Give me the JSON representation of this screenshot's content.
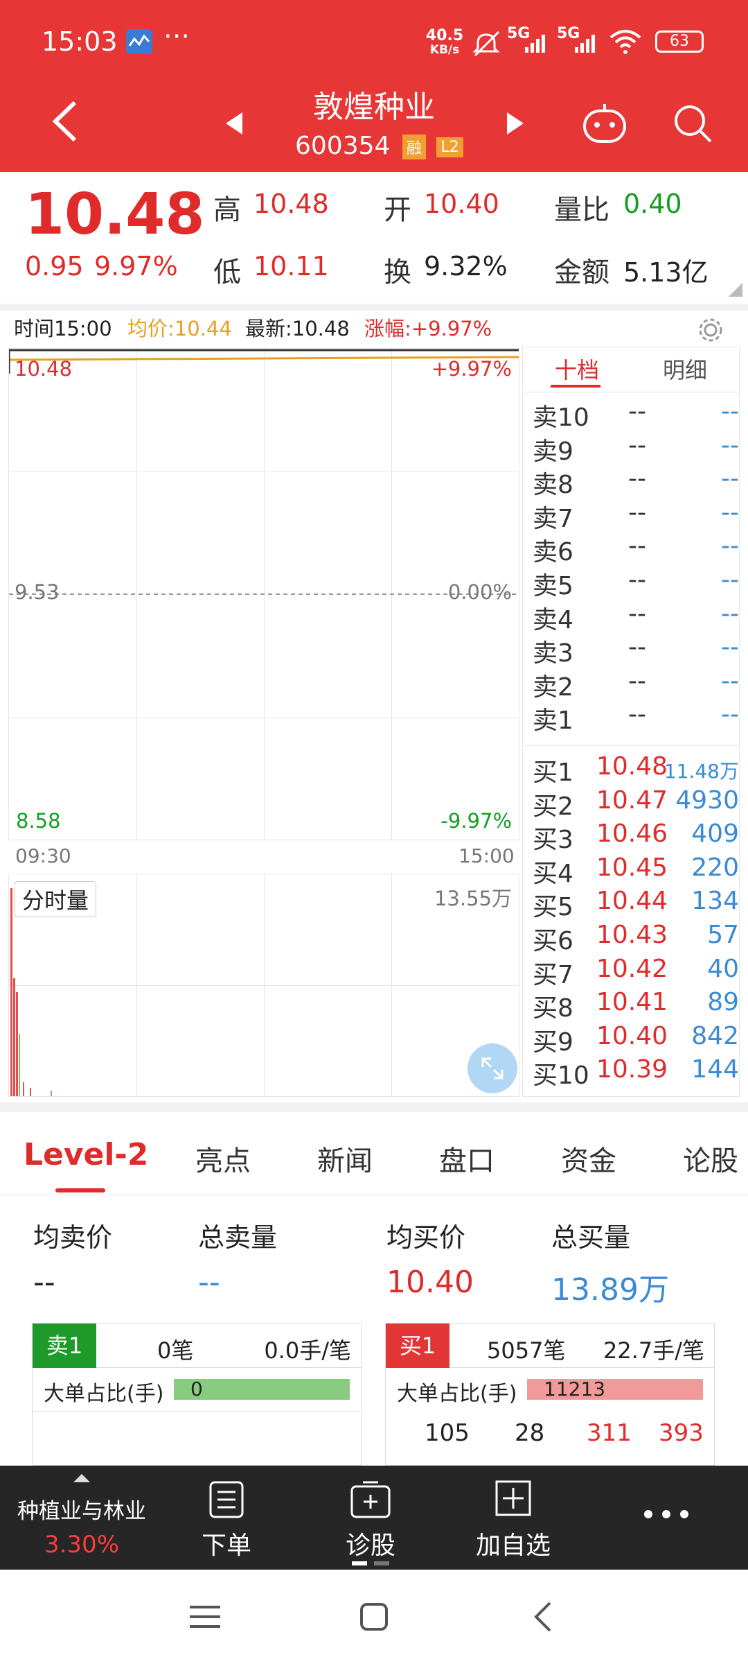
{
  "status": {
    "time": "15:03",
    "net_speed_top": "40.5",
    "net_speed_bottom": "KB/s",
    "signal1": "5G",
    "signal2": "5G",
    "battery": "63"
  },
  "nav": {
    "title": "敦煌种业",
    "code": "600354",
    "badge_rong": "融",
    "badge_l2": "L2"
  },
  "quote": {
    "price": "10.48",
    "change": "0.95",
    "change_pct": "9.97%",
    "high_label": "高",
    "high": "10.48",
    "low_label": "低",
    "low": "10.11",
    "open_label": "开",
    "open": "10.40",
    "turnover_label": "换",
    "turnover": "9.32%",
    "volratio_label": "量比",
    "volratio": "0.40",
    "amount_label": "金额",
    "amount": "5.13亿"
  },
  "chart_info": {
    "time": "时间15:00",
    "avg": "均价:10.44",
    "latest": "最新:10.48",
    "change": "涨幅:+9.97%"
  },
  "chart": {
    "price_high": "10.48",
    "price_mid": "9.53",
    "price_low": "8.58",
    "pct_high": "+9.97%",
    "pct_mid": "0.00%",
    "pct_low": "-9.97%",
    "time_start": "09:30",
    "time_end": "15:00",
    "volume_label": "分时量",
    "volume_max": "13.55万"
  },
  "orderbook": {
    "tab_ten": "十档",
    "tab_detail": "明细",
    "sells": [
      {
        "label": "卖10",
        "price": "--",
        "vol": "--"
      },
      {
        "label": "卖9",
        "price": "--",
        "vol": "--"
      },
      {
        "label": "卖8",
        "price": "--",
        "vol": "--"
      },
      {
        "label": "卖7",
        "price": "--",
        "vol": "--"
      },
      {
        "label": "卖6",
        "price": "--",
        "vol": "--"
      },
      {
        "label": "卖5",
        "price": "--",
        "vol": "--"
      },
      {
        "label": "卖4",
        "price": "--",
        "vol": "--"
      },
      {
        "label": "卖3",
        "price": "--",
        "vol": "--"
      },
      {
        "label": "卖2",
        "price": "--",
        "vol": "--"
      },
      {
        "label": "卖1",
        "price": "--",
        "vol": "--"
      }
    ],
    "buys": [
      {
        "label": "买1",
        "price": "10.48",
        "vol": "11.48万"
      },
      {
        "label": "买2",
        "price": "10.47",
        "vol": "4930"
      },
      {
        "label": "买3",
        "price": "10.46",
        "vol": "409"
      },
      {
        "label": "买4",
        "price": "10.45",
        "vol": "220"
      },
      {
        "label": "买5",
        "price": "10.44",
        "vol": "134"
      },
      {
        "label": "买6",
        "price": "10.43",
        "vol": "57"
      },
      {
        "label": "买7",
        "price": "10.42",
        "vol": "40"
      },
      {
        "label": "买8",
        "price": "10.41",
        "vol": "89"
      },
      {
        "label": "买9",
        "price": "10.40",
        "vol": "842"
      },
      {
        "label": "买10",
        "price": "10.39",
        "vol": "144"
      }
    ]
  },
  "tabs": [
    "Level-2",
    "亮点",
    "新闻",
    "盘口",
    "资金",
    "论股"
  ],
  "level2": {
    "avg_sell_label": "均卖价",
    "avg_sell": "--",
    "total_sell_label": "总卖量",
    "total_sell": "--",
    "avg_buy_label": "均买价",
    "avg_buy": "10.40",
    "total_buy_label": "总买量",
    "total_buy": "13.89万",
    "sell_badge": "卖1",
    "sell_orders": "0笔",
    "sell_per": "0.0手/笔",
    "buy_badge": "买1",
    "buy_orders": "5057笔",
    "buy_per": "22.7手/笔",
    "big_ratio_label": "大单占比(手)",
    "sell_big": "0",
    "buy_big": "11213",
    "buy_queue": [
      "105",
      "28",
      "311",
      "393"
    ]
  },
  "toolbar": {
    "sector_name": "种植业与林业",
    "sector_pct": "3.30%",
    "order": "下单",
    "diagnose": "诊股",
    "add_watch": "加自选"
  },
  "colors": {
    "header_red": "#e63636",
    "up_red": "#e02b2b",
    "down_green": "#12a020",
    "vol_blue": "#3a8ad6",
    "avg_yellow": "#e6a020"
  }
}
